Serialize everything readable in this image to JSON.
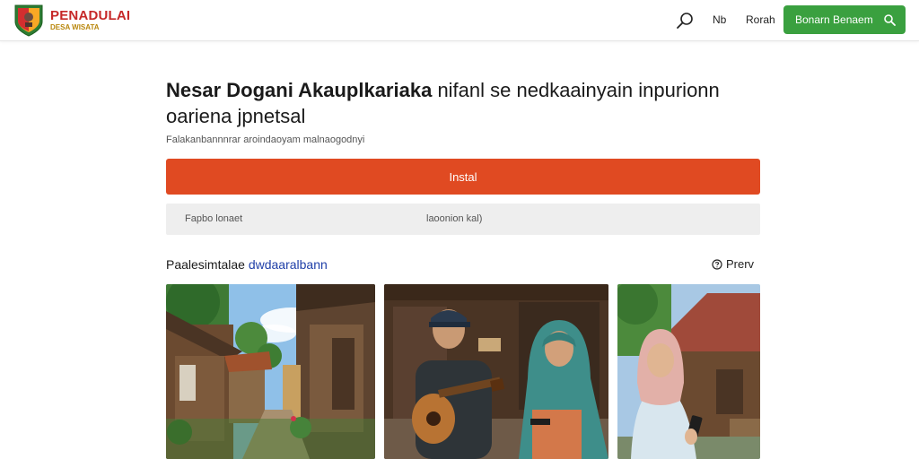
{
  "header": {
    "brand_name": "PENADULAI",
    "brand_sub": "DESA WISATA",
    "nav": [
      "Nb",
      "Rorah"
    ],
    "cta_label": "Bonarn Benaem",
    "icons": {
      "logo": "shield-crest-icon",
      "search": "search-icon",
      "cta": "search-icon"
    }
  },
  "main": {
    "title_bold": "Nesar Dogani Akauplkariaka",
    "title_rest": "nifanl se nedkaainyain inpurionn oariena jpnetsal",
    "subtitle": "Falakanbannnrar aroindaoyam malnaogodnyi",
    "install_label": "Instal",
    "info": [
      "Fapbo lonaet",
      "laoonion kal)"
    ],
    "section_title": "Paalesimtalae",
    "section_highlight": "dwdaaralbann",
    "preview_label": "Prerv"
  },
  "photos": [
    {
      "name": "village-street-photo",
      "description": "wooden houses along a village path"
    },
    {
      "name": "musicians-photo",
      "description": "man with guitar and woman in hijab"
    },
    {
      "name": "woman-phone-photo",
      "description": "woman in hijab holding phone"
    }
  ],
  "colors": {
    "brand": "#c62828",
    "cta": "#3aa03f",
    "install": "#e04a22",
    "highlight": "#1f3fa8"
  }
}
